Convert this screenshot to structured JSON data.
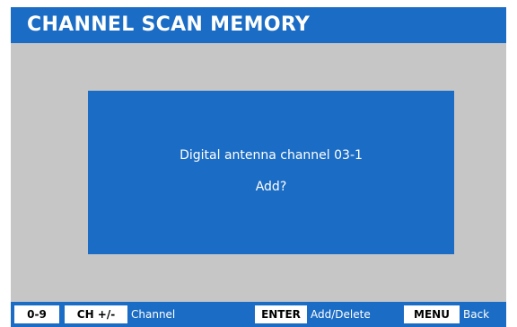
{
  "title": "CHANNEL SCAN MEMORY",
  "dialog": {
    "line1": "Digital antenna channel 03-1",
    "line2": "Add?"
  },
  "footer": {
    "keys": [
      {
        "key": "0-9"
      },
      {
        "key": "CH +/-",
        "label": "Channel"
      },
      {
        "key": "ENTER",
        "label": "Add/Delete"
      },
      {
        "key": "MENU",
        "label": "Back"
      }
    ]
  },
  "colors": {
    "accent_blue": "#1b6cc4",
    "background_gray": "#c6c6c6",
    "text": "#ffffff"
  }
}
